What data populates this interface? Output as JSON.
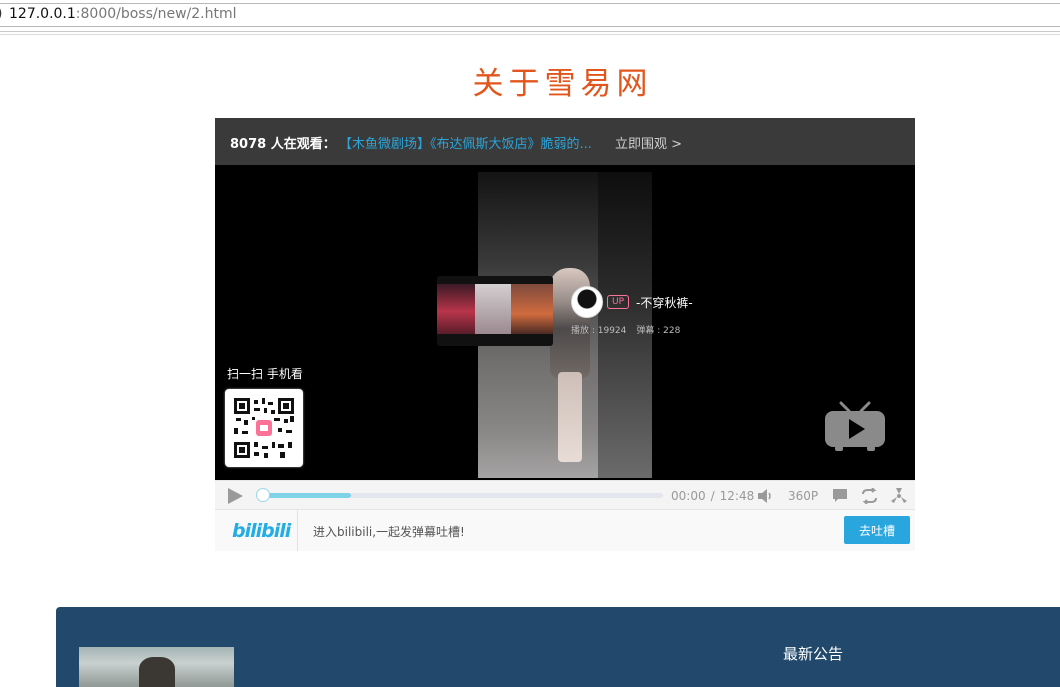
{
  "browser": {
    "url_host": "127.0.0.1",
    "url_rest": ":8000/boss/new/2.html"
  },
  "page": {
    "title": "关于雪易网"
  },
  "player": {
    "viewers_label": "8078 人在观看：",
    "now_playing": "【木鱼微剧场】《布达佩斯大饭店》脆弱的...",
    "watch_now": "立即围观 >",
    "up_badge": "UP",
    "up_name": "-不穿秋裤-",
    "plays_label": "播放 : 19924",
    "danmaku_label": "弹幕 : 228",
    "scan_label": "扫一扫 手机看",
    "time_current": "00:00",
    "time_separator": "/",
    "time_total": "12:48",
    "quality": "360P",
    "buffer_fraction": 0.22,
    "bilibili_logo": "bilibili",
    "danmaku_prompt": "进入bilibili,一起发弹幕吐槽!",
    "send_button": "去吐槽",
    "accent_color": "#2aa6de"
  },
  "footer": {
    "notice_heading": "最新公告"
  }
}
